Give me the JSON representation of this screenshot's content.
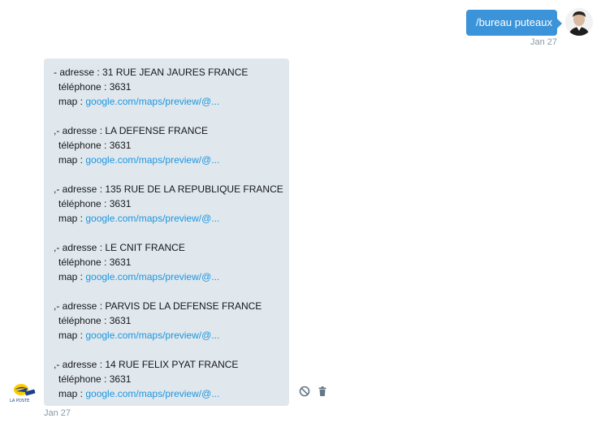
{
  "outgoing": {
    "text": "/bureau puteaux",
    "time": "Jan 27"
  },
  "incoming": {
    "time": "Jan 27",
    "entries": [
      {
        "address": "- adresse : 31 RUE JEAN JAURES FRANCE",
        "phone": "téléphone : 3631",
        "map_label": "map : ",
        "map_link": "google.com/maps/preview/@..."
      },
      {
        "address": ",- adresse : LA DEFENSE FRANCE",
        "phone": "téléphone : 3631",
        "map_label": "map : ",
        "map_link": "google.com/maps/preview/@..."
      },
      {
        "address": ",- adresse : 135 RUE DE LA REPUBLIQUE FRANCE",
        "phone": "téléphone : 3631",
        "map_label": "map : ",
        "map_link": "google.com/maps/preview/@..."
      },
      {
        "address": ",- adresse : LE CNIT FRANCE",
        "phone": "téléphone : 3631",
        "map_label": "map : ",
        "map_link": "google.com/maps/preview/@..."
      },
      {
        "address": ",- adresse : PARVIS DE LA DEFENSE FRANCE",
        "phone": "téléphone : 3631",
        "map_label": "map : ",
        "map_link": "google.com/maps/preview/@..."
      },
      {
        "address": ",- adresse : 14 RUE FELIX PYAT FRANCE",
        "phone": "téléphone : 3631",
        "map_label": "map : ",
        "map_link": "google.com/maps/preview/@..."
      }
    ]
  },
  "bot_avatar": {
    "logo_text": "LA POSTE"
  },
  "icons": {
    "block": "block-icon",
    "delete": "trash-icon"
  },
  "colors": {
    "outgoing_bubble": "#3b94d9",
    "incoming_bubble": "#e1e8ed",
    "link": "#1b95e0",
    "timestamp": "#8899a6"
  }
}
